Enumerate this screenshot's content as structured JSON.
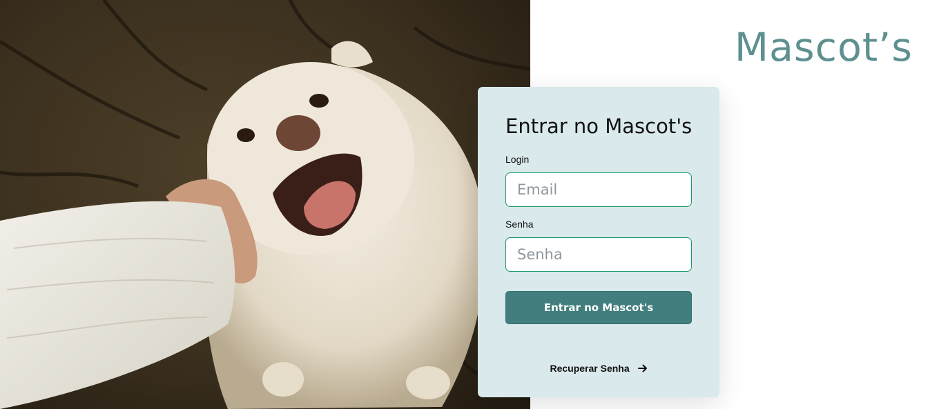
{
  "brand": {
    "logo_text": "Mascot’s",
    "color": "#5e9090"
  },
  "hero": {
    "icon": "dog-photo"
  },
  "login_card": {
    "title": "Entrar no Mascot's",
    "login_label": "Login",
    "email_placeholder": "Email",
    "password_label": "Senha",
    "password_placeholder": "Senha",
    "submit_label": "Entrar no Mascot's",
    "recover_label": "Recuperar Senha",
    "recover_icon": "arrow-right-icon"
  },
  "colors": {
    "card_bg": "#dae9eb",
    "button_bg": "#427e7e",
    "input_border": "#1b9a6c"
  }
}
